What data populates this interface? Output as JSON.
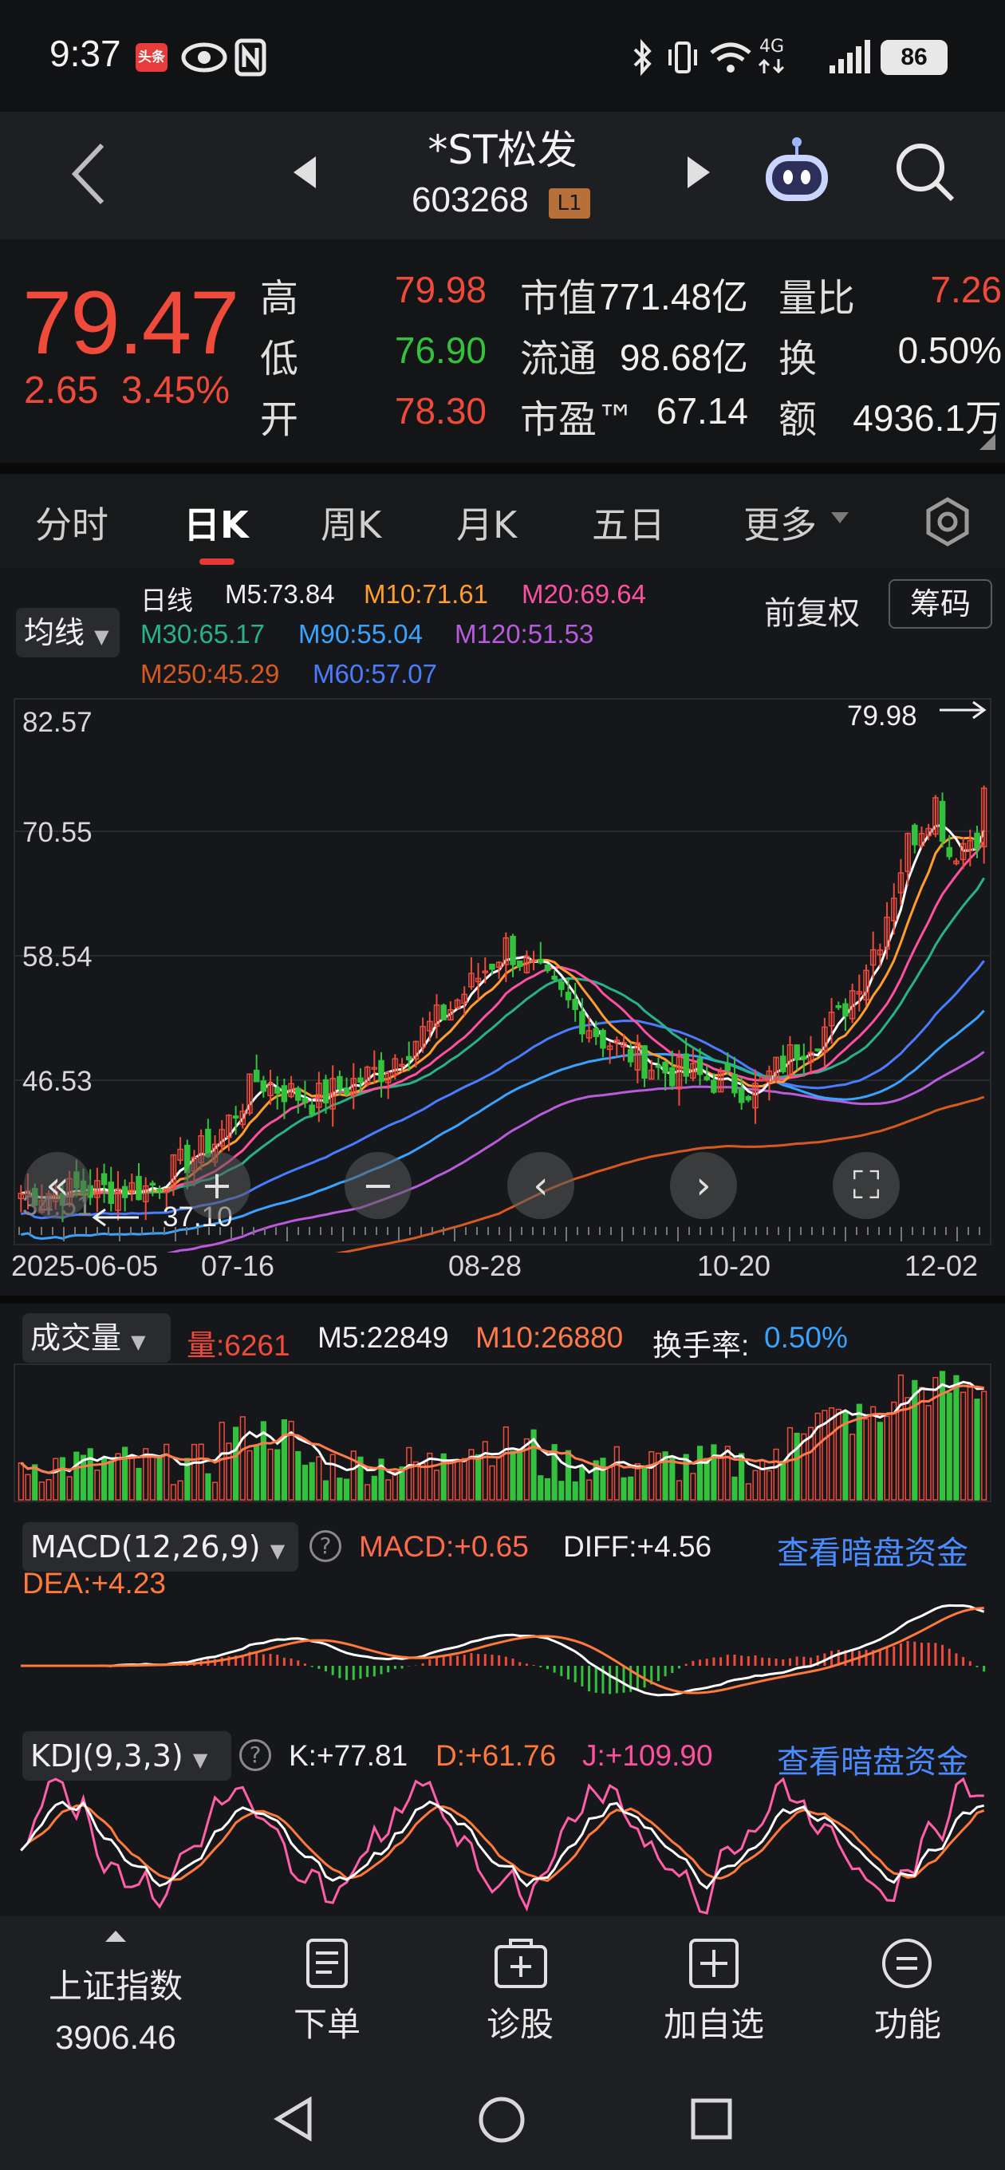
{
  "status": {
    "time": "9:37",
    "app_badge": "头条",
    "battery": "86"
  },
  "header": {
    "name": "*ST松发",
    "code": "603268",
    "level": "L1"
  },
  "quote": {
    "price": "79.47",
    "change": "2.65",
    "change_pct": "3.45%",
    "rows": [
      {
        "l1": "高",
        "v1": "79.98",
        "l2": "市值",
        "v2": "771.48亿",
        "l3": "量比",
        "v3": "7.26"
      },
      {
        "l1": "低",
        "v1": "76.90",
        "l2": "流通",
        "v2": "98.68亿",
        "l3": "换",
        "v3": "0.50%"
      },
      {
        "l1": "开",
        "v1": "78.30",
        "l2": "市盈™",
        "v2": "67.14",
        "l3": "额",
        "v3": "4936.1万"
      }
    ]
  },
  "tabs": [
    "分时",
    "日K",
    "周K",
    "月K",
    "五日",
    "更多"
  ],
  "ma": {
    "selector": "均线",
    "period": "日线",
    "m5": "M5:73.84",
    "m10": "M10:71.61",
    "m20": "M20:69.64",
    "m30": "M30:65.17",
    "m90": "M90:55.04",
    "m120": "M120:51.53",
    "m250": "M250:45.29",
    "m60": "M60:57.07",
    "fq": "前复权",
    "chip": "筹码"
  },
  "kline": {
    "y_ticks": [
      "82.57",
      "70.55",
      "58.54",
      "46.53",
      "34.51"
    ],
    "high_mark": "79.98",
    "low_mark": "37.10",
    "dates": [
      "2025-06-05",
      "07-16",
      "08-28",
      "10-20",
      "12-02"
    ]
  },
  "volume": {
    "selector": "成交量",
    "vol": "量:6261",
    "m5": "M5:22849",
    "m10": "M10:26880",
    "turnover_label": "换手率:",
    "turnover": "0.50%"
  },
  "macd": {
    "selector": "MACD(12,26,9)",
    "macd": "MACD:+0.65",
    "diff": "DIFF:+4.56",
    "dea": "DEA:+4.23",
    "link": "查看暗盘资金"
  },
  "kdj": {
    "selector": "KDJ(9,3,3)",
    "k": "K:+77.81",
    "d": "D:+61.76",
    "j": "J:+109.90",
    "link": "查看暗盘资金"
  },
  "bottom": {
    "index_name": "上证指数",
    "index_value": "3906.46",
    "items": [
      "下单",
      "诊股",
      "加自选",
      "功能"
    ]
  },
  "colors": {
    "up": "#f04a3a",
    "down": "#33c23d",
    "m5": "#ffffff",
    "m10": "#ff9d2e",
    "m20": "#ff4fa0",
    "m30": "#27b28a",
    "m90": "#39a4ff",
    "m120": "#b85bdc",
    "m250": "#d65a20",
    "m60": "#4a7cff"
  }
}
